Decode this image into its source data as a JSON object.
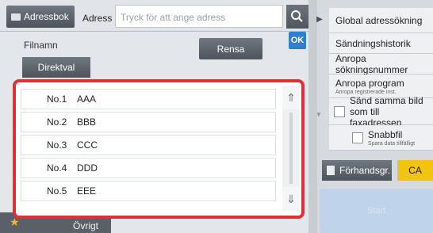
{
  "header": {
    "addressbook_label": "Adressbok",
    "address_label": "Adress",
    "address_placeholder": "Tryck för att ange adress",
    "search_icon": "search-icon"
  },
  "form": {
    "filename_label": "Filnamn",
    "clear_label": "Rensa",
    "ok_label": "OK",
    "direct_label": "Direktval",
    "other_label": "Övrigt"
  },
  "list": {
    "items": [
      {
        "num": "No.1",
        "name": "AAA"
      },
      {
        "num": "No.2",
        "name": "BBB"
      },
      {
        "num": "No.3",
        "name": "CCC"
      },
      {
        "num": "No.4",
        "name": "DDD"
      },
      {
        "num": "No.5",
        "name": "EEE"
      }
    ]
  },
  "sidebar": {
    "global_search": "Global adressökning",
    "send_history": "Sändningshistorik",
    "call_search_number": "Anropa sökningsnummer",
    "call_program": "Anropa program",
    "call_program_sub": "Anropa registrerade inst.",
    "send_same_line1": "Sänd samma bild",
    "send_same_line2": "som till faxadressen",
    "quick_file": "Snabbfil",
    "quick_file_sub": "Spara data tillfälligt"
  },
  "actions": {
    "preview_label": "Förhandsgr.",
    "ca_label": "CA",
    "start_label": "Start"
  },
  "colors": {
    "highlight": "#e03035",
    "accent_blue": "#2f7fd1",
    "ca_yellow": "#f1c40f"
  }
}
